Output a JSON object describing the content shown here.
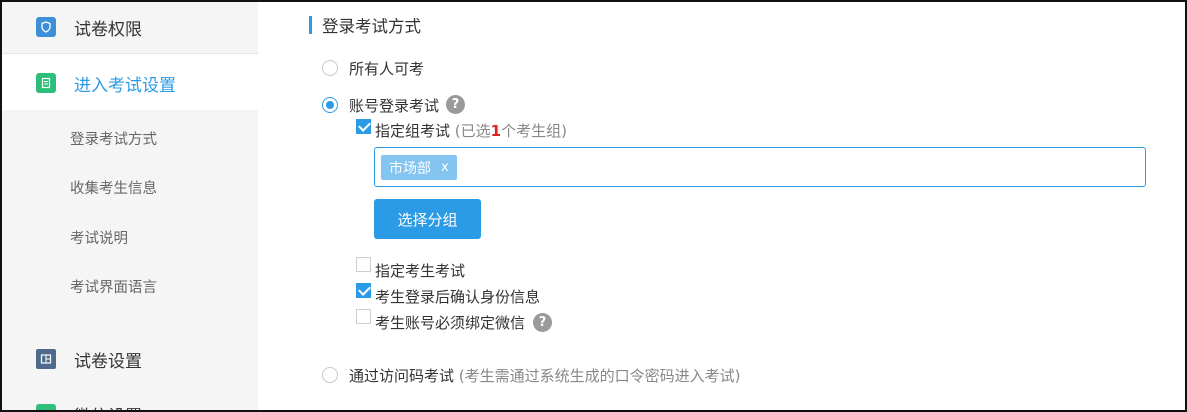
{
  "sidebar": {
    "items": [
      {
        "label": "试卷权限",
        "icon": "shield-icon"
      },
      {
        "label": "进入考试设置",
        "icon": "document-icon"
      },
      {
        "label": "试卷设置",
        "icon": "layout-icon"
      },
      {
        "label": "微信设置",
        "icon": "wechat-icon"
      }
    ],
    "subitems": [
      "登录考试方式",
      "收集考生信息",
      "考试说明",
      "考试界面语言"
    ]
  },
  "section": {
    "title": "登录考试方式"
  },
  "options": {
    "everyone": "所有人可考",
    "account": "账号登录考试",
    "access_code": "通过访问码考试",
    "access_code_hint": "(考生需通过系统生成的口令密码进入考试)"
  },
  "group": {
    "label": "指定组考试",
    "hint_prefix": "(已选",
    "hint_count": "1",
    "hint_suffix": "个考生组)",
    "tag": "市场部",
    "tag_remove": "x",
    "select_button": "选择分组"
  },
  "checks": {
    "specify_examinee": "指定考生考试",
    "confirm_identity": "考生登录后确认身份信息",
    "bind_wechat": "考生账号必须绑定微信"
  },
  "help_icon": "?",
  "colors": {
    "accent": "#2c9be6",
    "count": "#e02020"
  }
}
